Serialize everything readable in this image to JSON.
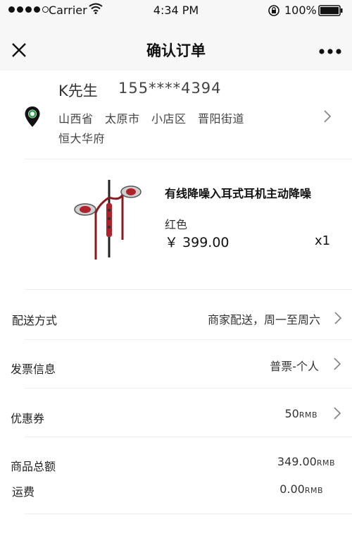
{
  "status_bar": {
    "carrier": "Carrier",
    "time": "4:34 PM",
    "battery": "100%"
  },
  "nav": {
    "title": "确认订单",
    "close_icon": "close-icon",
    "more_icon": "more-icon"
  },
  "address": {
    "name": "K先生",
    "phone": "155****4394",
    "line1": "山西省　太原市　小店区　晋阳街道",
    "line2": "恒大华府"
  },
  "product": {
    "name": "有线降噪入耳式耳机主动降噪",
    "color": "红色",
    "price": "￥ 399.00",
    "quantity": "x1"
  },
  "options": [
    {
      "label": "配送方式",
      "value": "商家配送，周一至周六"
    },
    {
      "label": "发票信息",
      "value": "普票-个人"
    },
    {
      "label": "优惠券",
      "value": "50",
      "unit": "RMB"
    }
  ],
  "summary": [
    {
      "label": "商品总额",
      "value": "349.00",
      "unit": "RMB"
    },
    {
      "label": "运费",
      "value": "0.00",
      "unit": "RMB"
    }
  ],
  "colors": {
    "location_ring": "#2e9e4a",
    "chevron": "#888888",
    "product_red": "#b0222a"
  }
}
